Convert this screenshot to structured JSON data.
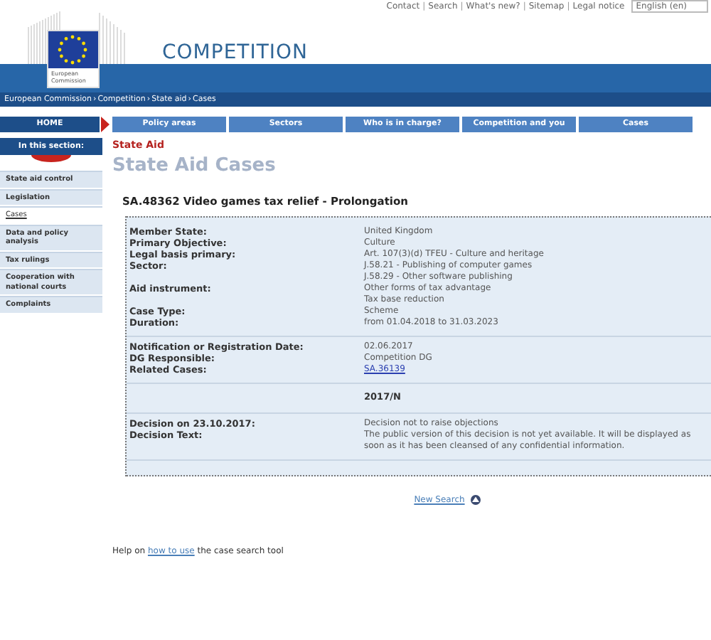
{
  "top_links": {
    "separator": "|",
    "items": [
      "Contact",
      "Search",
      "What's new?",
      "Sitemap",
      "Legal notice"
    ]
  },
  "language": "English (en)",
  "logo_text": [
    "European",
    "Commission"
  ],
  "site_title": "COMPETITION",
  "breadcrumb": {
    "separator": "›",
    "items": [
      "European Commission",
      "Competition",
      "State aid",
      "Cases"
    ]
  },
  "nav": [
    {
      "label": "HOME",
      "selected": true
    },
    {
      "label": "Policy areas",
      "selected": false
    },
    {
      "label": "Sectors",
      "selected": false
    },
    {
      "label": "Who is in charge?",
      "selected": false
    },
    {
      "label": "Competition and you",
      "selected": false
    },
    {
      "label": "Cases",
      "selected": false
    }
  ],
  "sidebar": {
    "heading": "In this section:",
    "items": [
      {
        "label": "State aid control",
        "selected": false
      },
      {
        "label": "Legislation",
        "selected": false
      },
      {
        "label": "Cases",
        "selected": true
      },
      {
        "label": "Data and policy analysis",
        "selected": false
      },
      {
        "label": "Tax rulings",
        "selected": false
      },
      {
        "label": "Cooperation with national courts",
        "selected": false
      },
      {
        "label": "Complaints",
        "selected": false
      }
    ]
  },
  "section_label": "State Aid",
  "page_title": "State Aid Cases",
  "case_title": "SA.48362 Video games tax relief - Prolongation",
  "details": [
    {
      "rows": [
        {
          "kind": "text",
          "label": "Member State:",
          "values": [
            "United Kingdom"
          ]
        },
        {
          "kind": "text",
          "label": "Primary Objective:",
          "values": [
            "Culture"
          ]
        },
        {
          "kind": "text",
          "label": "Legal basis primary:",
          "values": [
            "Art. 107(3)(d) TFEU - Culture and heritage"
          ]
        },
        {
          "kind": "text",
          "label": "Sector:",
          "values": [
            "J.58.21 - Publishing of computer games",
            "J.58.29 - Other software publishing"
          ]
        },
        {
          "kind": "text",
          "label": "Aid instrument:",
          "values": [
            "Other forms of tax advantage",
            "Tax base reduction"
          ]
        },
        {
          "kind": "text",
          "label": "Case Type:",
          "values": [
            "Scheme"
          ]
        },
        {
          "kind": "text",
          "label": "Duration:",
          "values": [
            "from 01.04.2018 to 31.03.2023"
          ]
        }
      ]
    },
    {
      "rows": [
        {
          "kind": "text",
          "label": "Notification or Registration Date:",
          "values": [
            "02.06.2017"
          ]
        },
        {
          "kind": "text",
          "label": "DG Responsible:",
          "values": [
            "Competition DG"
          ]
        },
        {
          "kind": "link",
          "label": "Related Cases:",
          "values": [
            "SA.36139"
          ]
        }
      ]
    },
    {
      "rows": [
        {
          "kind": "heading",
          "values": [
            "2017/N"
          ]
        }
      ]
    },
    {
      "rows": [
        {
          "kind": "text",
          "label": "Decision on 23.10.2017:",
          "values": [
            "Decision not to raise objections"
          ]
        },
        {
          "kind": "text",
          "label": "Decision Text:",
          "values": [
            "The public version of this decision is not yet available. It will be displayed as soon as it has been cleansed of any confidential information."
          ]
        }
      ]
    }
  ],
  "new_search": "New Search",
  "help": {
    "before": "Help on",
    "link": "how to use",
    "after": "the case search tool"
  }
}
